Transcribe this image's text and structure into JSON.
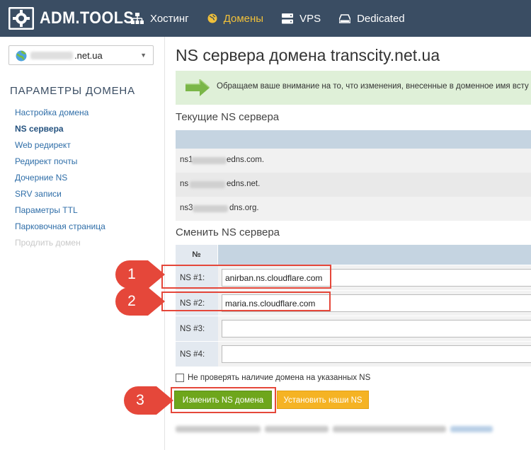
{
  "topbar": {
    "logo_text": "ADM.TOOLS",
    "nav": [
      {
        "label": "Хостинг",
        "icon": "sitemap-icon",
        "active": false
      },
      {
        "label": "Домены",
        "icon": "globe-icon",
        "active": true
      },
      {
        "label": "VPS",
        "icon": "server-icon",
        "active": false
      },
      {
        "label": "Dedicated",
        "icon": "drive-icon",
        "active": false
      }
    ]
  },
  "sidebar": {
    "domain_suffix": ".net.ua",
    "section_title": "ПАРАМЕТРЫ ДОМЕНА",
    "menu": [
      {
        "label": "Настройка домена",
        "state": "normal"
      },
      {
        "label": "NS сервера",
        "state": "current"
      },
      {
        "label": "Web редирект",
        "state": "normal"
      },
      {
        "label": "Редирект почты",
        "state": "normal"
      },
      {
        "label": "Дочерние NS",
        "state": "normal"
      },
      {
        "label": "SRV записи",
        "state": "normal"
      },
      {
        "label": "Параметры TTL",
        "state": "normal"
      },
      {
        "label": "Парковочная страница",
        "state": "normal"
      },
      {
        "label": "Продлить домен",
        "state": "disabled"
      }
    ]
  },
  "main": {
    "title": "NS сервера домена transcity.net.ua",
    "notice": "Обращаем ваше внимание на то, что изменения, внесенные в доменное имя всту",
    "current_title": "Текущие NS сервера",
    "current_ns": [
      {
        "prefix": "ns1",
        "suffix": "edns.com."
      },
      {
        "prefix": "ns",
        "suffix": "edns.net."
      },
      {
        "prefix": "ns3",
        "suffix": "dns.org."
      }
    ],
    "change_title": "Сменить NS сервера",
    "change_header_num": "№",
    "change_rows": [
      {
        "label": "NS #1:",
        "value": "anirban.ns.cloudflare.com"
      },
      {
        "label": "NS #2:",
        "value": "maria.ns.cloudflare.com"
      },
      {
        "label": "NS #3:",
        "value": ""
      },
      {
        "label": "NS #4:",
        "value": ""
      }
    ],
    "checkbox_label": "Не проверять наличие домена на указанных NS",
    "btn_change": "Изменить NS домена",
    "btn_set_ours": "Установить наши NS"
  },
  "callouts": [
    "1",
    "2",
    "3"
  ],
  "colors": {
    "topbar": "#3a4d63",
    "accent_active": "#f0c03a",
    "green_btn": "#6ea61c",
    "orange_btn": "#f5b324",
    "callout_red": "#e5473a"
  }
}
